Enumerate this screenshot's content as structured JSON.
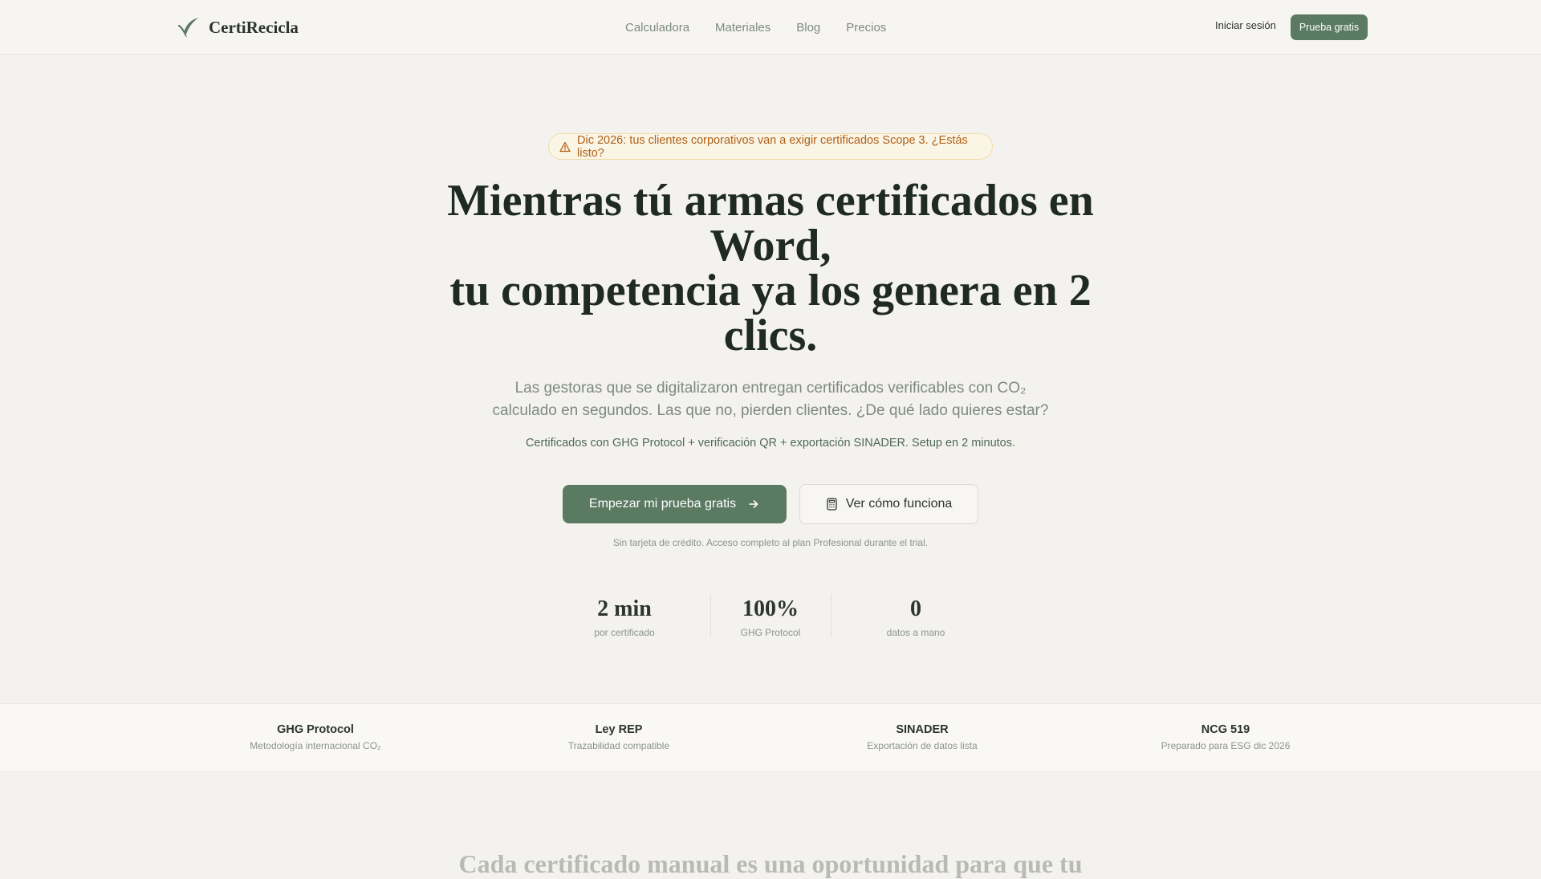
{
  "header": {
    "brand": "CertiRecicla",
    "nav": [
      "Calculadora",
      "Materiales",
      "Blog",
      "Precios"
    ],
    "login_label": "Iniciar sesión",
    "trial_label": "Prueba gratis"
  },
  "hero": {
    "alert": "Dic 2026: tus clientes corporativos van a exigir certificados Scope 3. ¿Estás listo?",
    "title_lines": [
      "Mientras tú armas certificados en",
      "Word,",
      "tu competencia ya los genera en 2",
      "clics."
    ],
    "subtitle_lines": [
      "Las gestoras que se digitalizaron entregan certificados verificables con CO₂",
      "calculado en segundos. Las que no, pierden clientes. ¿De qué lado quieres estar?"
    ],
    "features": "Certificados con GHG Protocol + verificación QR + exportación SINADER. Setup en 2 minutos.",
    "cta_primary": "Empezar mi prueba gratis",
    "cta_secondary": "Ver cómo funciona",
    "note": "Sin tarjeta de crédito. Acceso completo al plan Profesional durante el trial."
  },
  "stats": [
    {
      "value": "2 min",
      "label": "por certificado"
    },
    {
      "value": "100%",
      "label": "GHG Protocol"
    },
    {
      "value": "0",
      "label": "datos a mano"
    }
  ],
  "compliance": [
    {
      "title": "GHG Protocol",
      "subtitle": "Metodología internacional CO₂"
    },
    {
      "title": "Ley REP",
      "subtitle": "Trazabilidad compatible"
    },
    {
      "title": "SINADER",
      "subtitle": "Exportación de datos lista"
    },
    {
      "title": "NCG 519",
      "subtitle": "Preparado para ESG dic 2026"
    }
  ],
  "next_section_title": "Cada certificado manual es una oportunidad para que tu",
  "colors": {
    "primary": "#5b7a62",
    "background": "#f4f2ee",
    "alert_text": "#b06016",
    "alert_bg": "#fbf5e6"
  },
  "icons": {
    "brand": "leaf-icon",
    "alert": "warning-triangle-icon",
    "cta_primary": "arrow-right-icon",
    "cta_secondary": "calculator-icon"
  }
}
